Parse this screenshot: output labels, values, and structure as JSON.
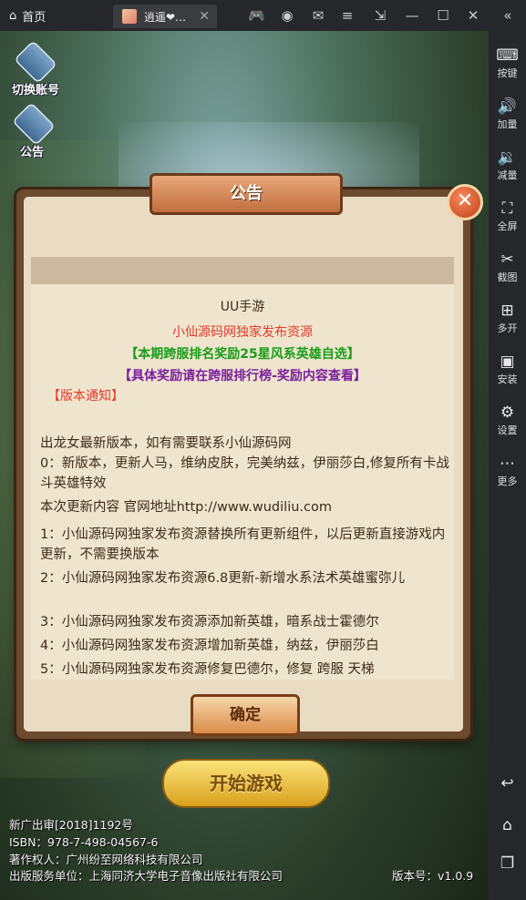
{
  "titlebar": {
    "home_label": "首页",
    "game_tab_label": "逍遥❤…",
    "icons": [
      "gamepad-icon",
      "user-icon",
      "mail-icon",
      "menu-icon",
      "fullscreen-exit-icon",
      "minimize-icon",
      "maximize-icon",
      "close-icon"
    ]
  },
  "sidebar": {
    "items": [
      {
        "label": "按键",
        "icon": "keyboard-icon",
        "glyph": "⌨"
      },
      {
        "label": "加量",
        "icon": "volume-up-icon",
        "glyph": "🔊"
      },
      {
        "label": "减量",
        "icon": "volume-down-icon",
        "glyph": "🔉"
      },
      {
        "label": "全屏",
        "icon": "fullscreen-icon",
        "glyph": "⛶"
      },
      {
        "label": "截图",
        "icon": "scissors-icon",
        "glyph": "✂"
      },
      {
        "label": "多开",
        "icon": "multi-instance-icon",
        "glyph": "⊞"
      },
      {
        "label": "安装",
        "icon": "apk-icon",
        "glyph": "▣"
      },
      {
        "label": "设置",
        "icon": "gear-icon",
        "glyph": "⚙"
      },
      {
        "label": "更多",
        "icon": "more-icon",
        "glyph": "⋯"
      }
    ],
    "bottom": [
      {
        "icon": "back-icon",
        "glyph": "↩"
      },
      {
        "icon": "home-icon",
        "glyph": "⌂"
      },
      {
        "icon": "recent-apps-icon",
        "glyph": "❐"
      }
    ]
  },
  "game": {
    "switch_account": "切换账号",
    "notice_button": "公告",
    "dialog": {
      "title": "公告",
      "close": "✕",
      "header": "UU手游",
      "line_red": "小仙源码网独家发布资源",
      "line_green": "【本期跨服排名奖励25星风系英雄自选】",
      "line_purple": "【具体奖励请在跨服排行榜-奖励内容查看】",
      "line_notice": "【版本通知】",
      "paragraphs": [
        "出龙女最新版本，如有需要联系小仙源码网",
        "0：新版本，更新人马，维纳皮肤，完美纳兹，伊丽莎白,修复所有卡战斗英雄特效",
        "本次更新内容 官网地址http://www.wudiliu.com",
        "1：小仙源码网独家发布资源替换所有更新组件，以后更新直接游戏内更新，不需要换版本",
        "2：小仙源码网独家发布资源6.8更新-新增水系法术英雄蜜弥儿",
        "3：小仙源码网独家发布资源添加新英雄，暗系战士霍德尔",
        "4：小仙源码网独家发布资源增加新英雄，纳兹，伊丽莎白",
        "5：小仙源码网独家发布资源修复巴德尔，修复 跨服 天梯"
      ],
      "confirm": "确定"
    },
    "start_button": "开始游戏",
    "footer": {
      "line1": "新广出审[2018]1192号",
      "line2": "ISBN：978-7-498-04567-6",
      "line3": "著作权人：广州纷至网络科技有限公司",
      "line4": "出版服务单位：上海同济大学电子音像出版社有限公司",
      "version": "版本号：v1.0.9"
    }
  }
}
